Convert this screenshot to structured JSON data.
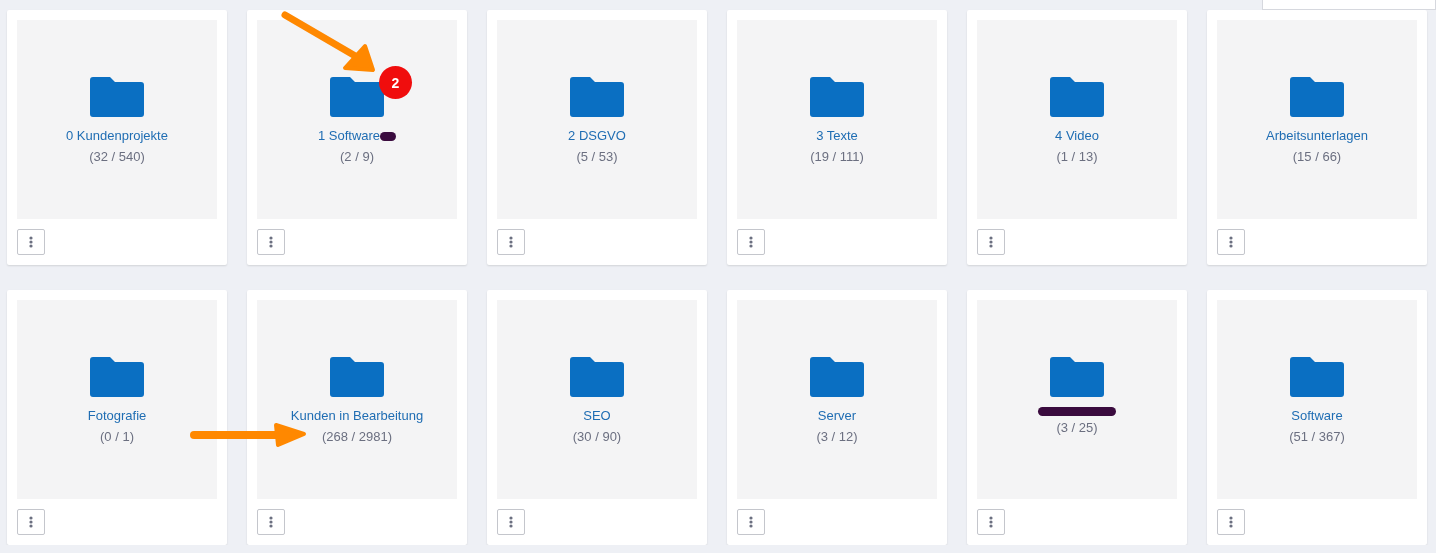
{
  "folders": [
    {
      "name": "0 Kundenprojekte",
      "count": "(32 / 540)",
      "redacted": false
    },
    {
      "name": "1 Software",
      "count": "(2 / 9)",
      "redacted": true,
      "badge": "2",
      "arrow": {
        "kind": "diagonal"
      }
    },
    {
      "name": "2 DSGVO",
      "count": "(5 / 53)",
      "redacted": false
    },
    {
      "name": "3 Texte",
      "count": "(19 / 111)",
      "redacted": false
    },
    {
      "name": "4 Video",
      "count": "(1 / 13)",
      "redacted": false
    },
    {
      "name": "Arbeitsunterlagen",
      "count": "(15 / 66)",
      "redacted": false
    },
    {
      "name": "Fotografie",
      "count": "(0 / 1)",
      "redacted": false
    },
    {
      "name": "Kunden in Bearbeitung",
      "count": "(268 / 2981)",
      "redacted": false,
      "arrow": {
        "kind": "horizontal"
      }
    },
    {
      "name": "SEO",
      "count": "(30 / 90)",
      "redacted": false
    },
    {
      "name": "Server",
      "count": "(3 / 12)",
      "redacted": false
    },
    {
      "count": "(3 / 25)",
      "redacted": true
    },
    {
      "name": "Software",
      "count": "(51 / 367)",
      "redacted": false
    }
  ]
}
